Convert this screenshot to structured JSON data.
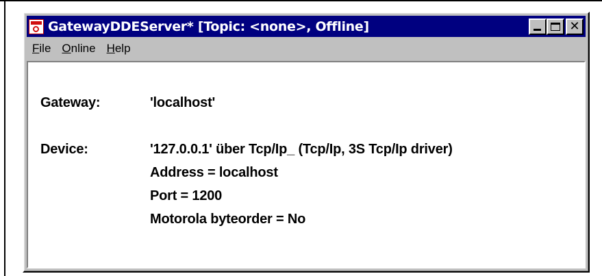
{
  "window": {
    "title": "GatewayDDEServer* [Topic: <none>, Offline]",
    "controls": {
      "minimize": "_",
      "maximize": "□",
      "close": "✕"
    }
  },
  "menu": [
    {
      "label": "File",
      "accel": "F",
      "rest": "ile"
    },
    {
      "label": "Online",
      "accel": "O",
      "rest": "nline"
    },
    {
      "label": "Help",
      "accel": "H",
      "rest": "elp"
    }
  ],
  "content": {
    "gateway_label": "Gateway:",
    "gateway_value": "'localhost'",
    "device_label": "Device:",
    "device_lines": [
      "'127.0.0.1' über Tcp/Ip_ (Tcp/Ip, 3S Tcp/Ip driver)",
      "Address = localhost",
      "Port = 1200",
      "Motorola byteorder = No"
    ]
  },
  "icons": {
    "app": "app-window-icon",
    "minimize": "minimize-icon",
    "maximize": "maximize-icon",
    "close": "close-icon"
  }
}
